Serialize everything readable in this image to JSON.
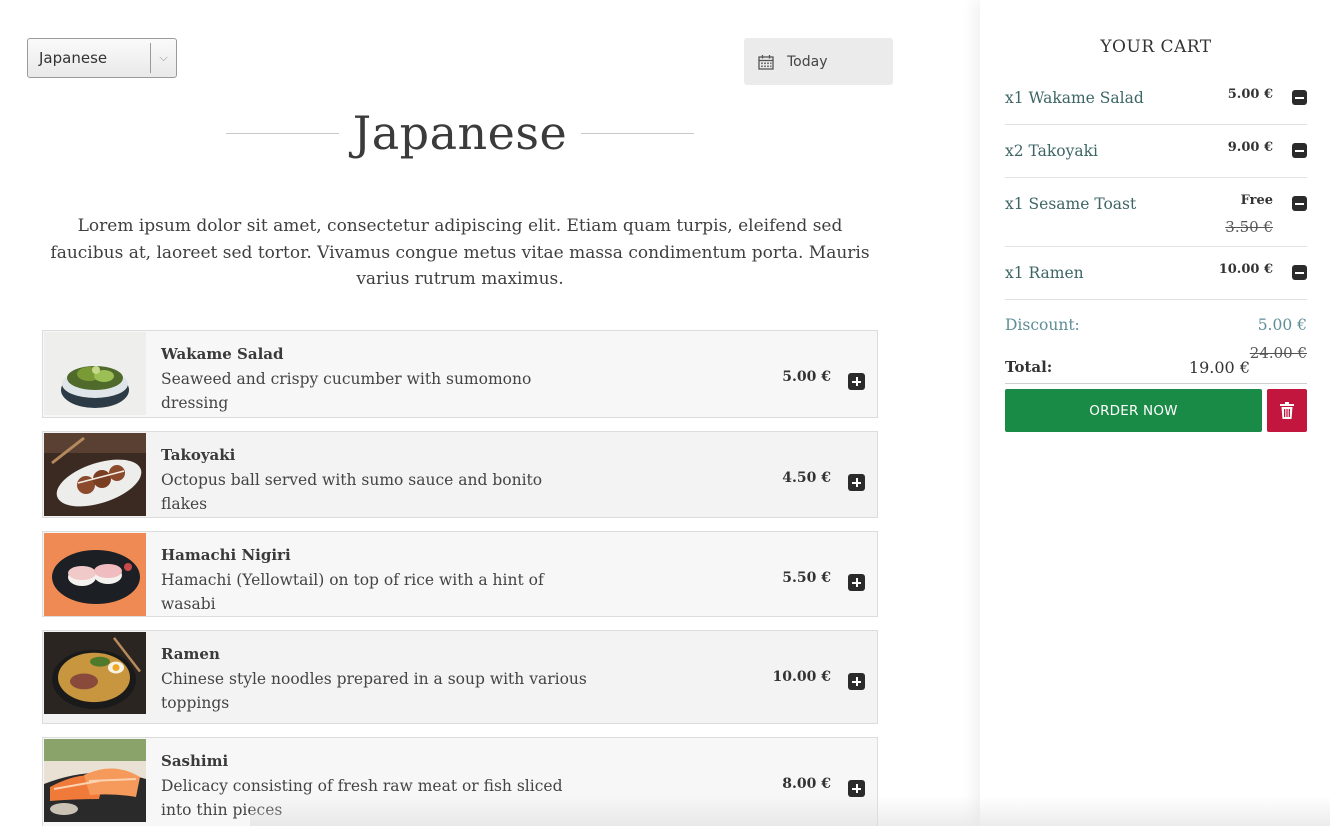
{
  "filters": {
    "cuisine_select": {
      "value": "Japanese",
      "arrow": "⌵"
    },
    "date_button": {
      "label": "Today",
      "icon": "calendar-icon"
    }
  },
  "page": {
    "title": "Japanese",
    "intro": "Lorem ipsum dolor sit amet, consectetur adipiscing elit. Etiam quam turpis, eleifend sed faucibus at, laoreet sed tortor. Vivamus congue metus vitae massa condimentum porta. Mauris varius rutrum maximus."
  },
  "menu": {
    "items": [
      {
        "name": "Wakame Salad",
        "description": "Seaweed and crispy cucumber with sumomono dressing",
        "price": "5.00 €",
        "image": "wakame-salad-photo"
      },
      {
        "name": "Takoyaki",
        "description": "Octopus ball served with sumo sauce and bonito flakes",
        "price": "4.50 €",
        "image": "takoyaki-photo"
      },
      {
        "name": "Hamachi Nigiri",
        "description": "Hamachi (Yellowtail) on top of rice with a hint of wasabi",
        "price": "5.50 €",
        "image": "hamachi-nigiri-photo"
      },
      {
        "name": "Ramen",
        "description": "Chinese style noodles prepared in a soup with various toppings",
        "price": "10.00 €",
        "image": "ramen-photo"
      },
      {
        "name": "Sashimi",
        "description": "Delicacy consisting of fresh raw meat or fish sliced into thin pieces",
        "price": "8.00 €",
        "image": "sashimi-photo"
      }
    ]
  },
  "cart": {
    "title": "YOUR CART",
    "items": [
      {
        "label": "x1 Wakame Salad",
        "price": "5.00 €",
        "old_price": ""
      },
      {
        "label": "x2 Takoyaki",
        "price": "9.00 €",
        "old_price": ""
      },
      {
        "label": "x1 Sesame Toast",
        "price": "Free",
        "old_price": "3.50 €"
      },
      {
        "label": "x1 Ramen",
        "price": "10.00 €",
        "old_price": ""
      }
    ],
    "discount_label": "Discount:",
    "discount_value": "5.00 €",
    "total_label": "Total:",
    "total_value": "19.00 €",
    "total_old_value": "24.00 €",
    "order_button": "ORDER NOW",
    "clear_icon": "trash-icon"
  },
  "colors": {
    "order_green": "#1a8a47",
    "trash_red": "#c2163f",
    "cart_item_teal": "#3d6565",
    "discount_blue": "#5f8e98"
  }
}
